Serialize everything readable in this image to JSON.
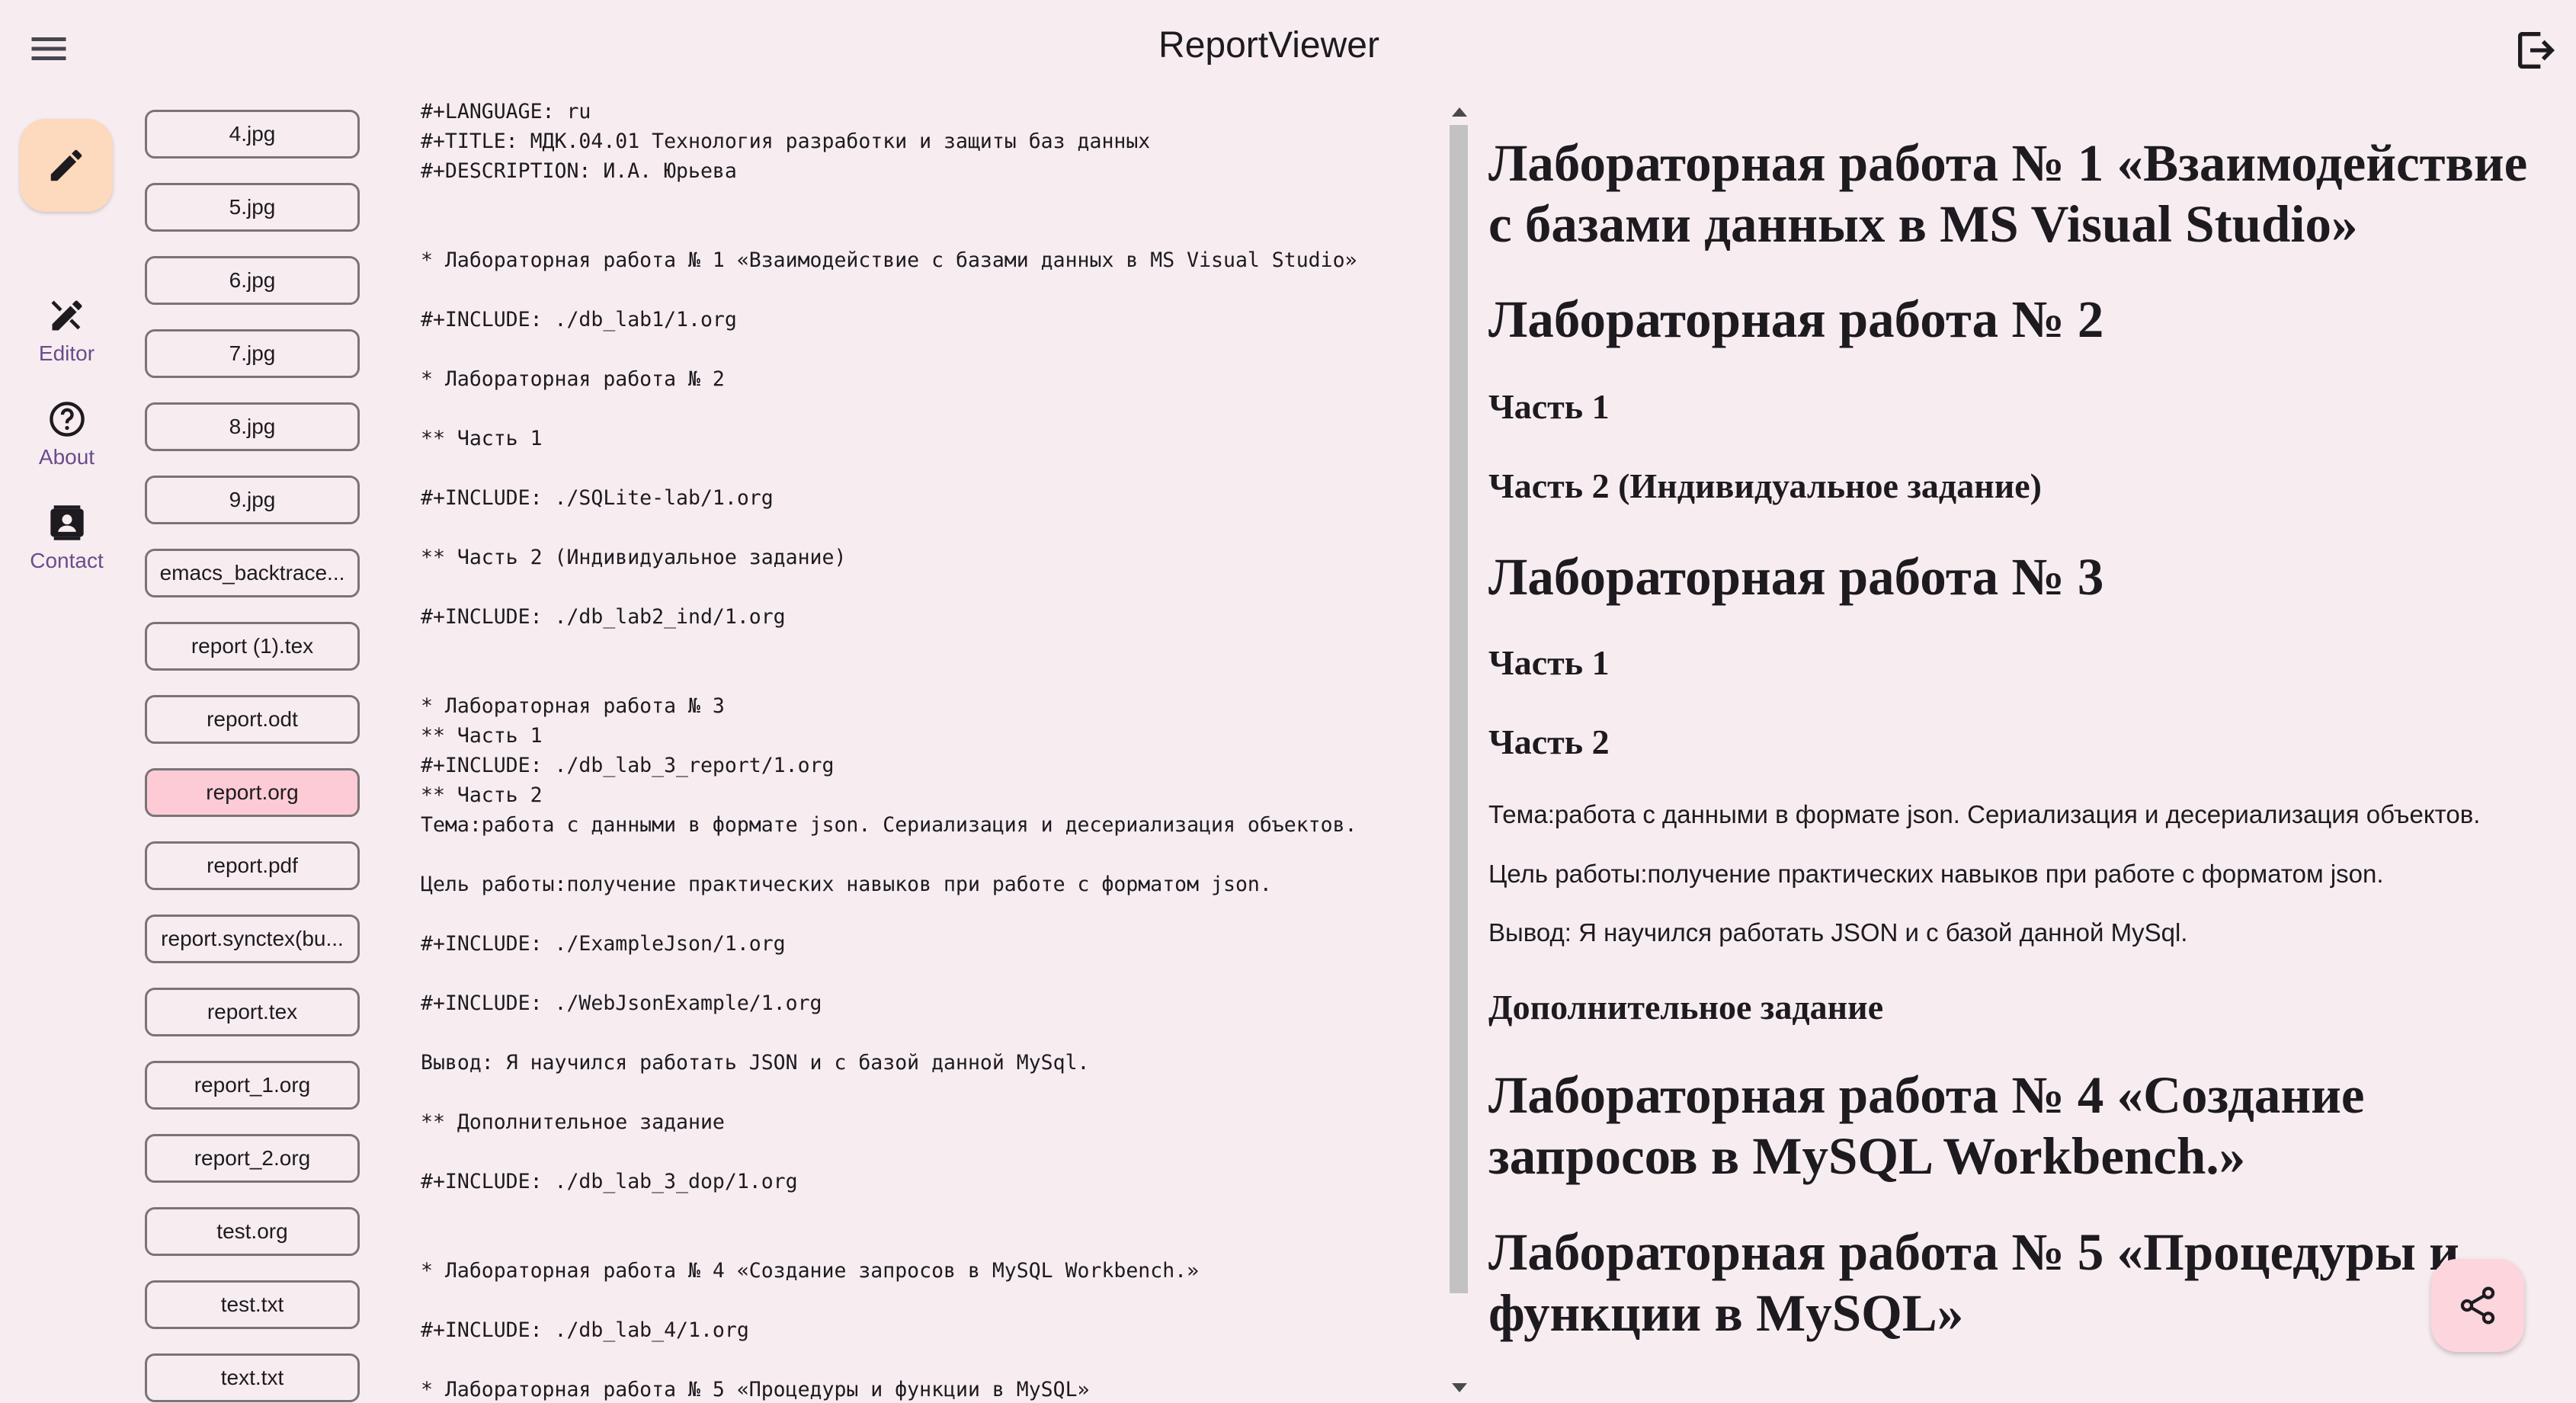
{
  "app": {
    "title": "ReportViewer"
  },
  "icons": {
    "menu": "menu-icon",
    "logout": "logout-icon",
    "edit": "pencil-icon",
    "editor": "edit-tools-icon",
    "about": "help-circle-icon",
    "contact": "contact-card-icon",
    "share": "share-icon"
  },
  "colors": {
    "background": "#f7edf1",
    "fab_edit": "#fdd9bd",
    "selected_file": "#fdcbd6",
    "share_fab": "#fdd5dd",
    "nav_label": "#6a4c8a"
  },
  "nav": {
    "editor": "Editor",
    "about": "About",
    "contact": "Contact"
  },
  "files": {
    "selected": "report.org",
    "items": [
      "4.jpg",
      "5.jpg",
      "6.jpg",
      "7.jpg",
      "8.jpg",
      "9.jpg",
      "emacs_backtrace...",
      "report (1).tex",
      "report.odt",
      "report.org",
      "report.pdf",
      "report.synctex(bu...",
      "report.tex",
      "report_1.org",
      "report_2.org",
      "test.org",
      "test.txt",
      "text.txt"
    ]
  },
  "editor": {
    "lines": [
      "#+LANGUAGE: ru",
      "#+TITLE: МДК.04.01 Технология разработки и защиты баз данных",
      "#+DESCRIPTION: И.А. Юрьева",
      "* Лабораторная работа № 1 «Взаимодействие с базами данных в MS Visual Studio»",
      "#+INCLUDE: ./db_lab1/1.org",
      "* Лабораторная работа № 2",
      "** Часть 1",
      "#+INCLUDE: ./SQLite-lab/1.org",
      "** Часть 2 (Индивидуальное задание)",
      "#+INCLUDE: ./db_lab2_ind/1.org",
      "* Лабораторная работа № 3",
      "** Часть 1",
      "#+INCLUDE: ./db_lab_3_report/1.org",
      "** Часть 2",
      "Тема:работа с данными в формате json. Сериализация и десериализация объектов.",
      "Цель работы:получение практических навыков при работе с форматом json.",
      "#+INCLUDE: ./ExampleJson/1.org",
      "#+INCLUDE: ./WebJsonExample/1.org",
      "Вывод: Я научился работать JSON и с базой данной MySql.",
      "** Дополнительное задание",
      "#+INCLUDE: ./db_lab_3_dop/1.org",
      "* Лабораторная работа № 4 «Создание запросов в MySQL Workbench.»",
      "#+INCLUDE: ./db_lab_4/1.org",
      "* Лабораторная работа № 5 «Процедуры и функции в MySQL»"
    ]
  },
  "preview": {
    "h_lab1": "Лабораторная работа № 1 «Взаимодействие с базами данных в MS Visual Studio»",
    "h_lab2": "Лабораторная работа № 2",
    "h_lab2_part1": "Часть 1",
    "h_lab2_part2": "Часть 2 (Индивидуальное задание)",
    "h_lab3": "Лабораторная работа № 3",
    "h_lab3_part1": "Часть 1",
    "h_lab3_part2": "Часть 2",
    "p_topic": "Тема:работа с данными в формате json. Сериализация и десериализация объектов.",
    "p_goal": "Цель работы:получение практических навыков при работе с форматом json.",
    "p_conclusion": "Вывод: Я научился работать JSON и с базой данной MySql.",
    "h_extra": "Дополнительное задание",
    "h_lab4": "Лабораторная работа № 4 «Создание запросов в MySQL Workbench.»",
    "h_lab5": "Лабораторная работа № 5 «Процедуры и функции в MySQL»"
  }
}
